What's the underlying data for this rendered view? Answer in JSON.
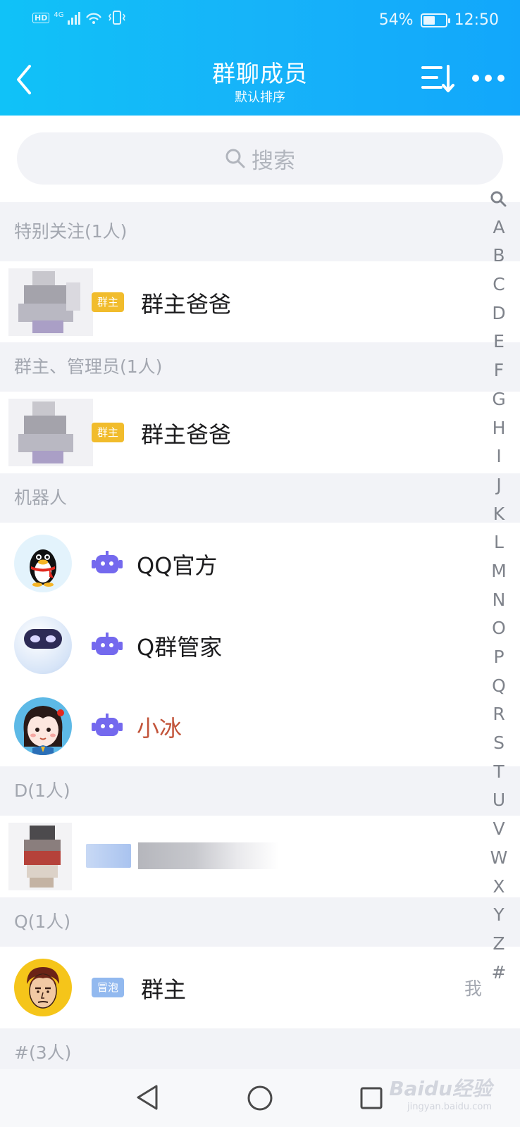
{
  "status_bar": {
    "hd_label": "HD",
    "network_label": "4G",
    "battery_percent_text": "54%",
    "battery_level": 0.54,
    "time": "12:50"
  },
  "header": {
    "title": "群聊成员",
    "subtitle": "默认排序",
    "back_icon": "chevron-left-icon",
    "sort_icon": "sort-icon",
    "more_icon": "more-horizontal-icon"
  },
  "search": {
    "placeholder": "搜索"
  },
  "sections": {
    "special": "特别关注(1人)",
    "admins": "群主、管理员(1人)",
    "robots": "机器人",
    "d": "D(1人)",
    "q": "Q(1人)",
    "hash": "#(3人)"
  },
  "members": {
    "special_member": {
      "tag": "群主",
      "name": "群主爸爸"
    },
    "admin_member": {
      "tag": "群主",
      "name": "群主爸爸"
    },
    "robot_1": {
      "name": "QQ官方"
    },
    "robot_2": {
      "name": "Q群管家"
    },
    "robot_3": {
      "name": "小冰"
    },
    "q_member": {
      "tag": "冒泡",
      "name": "群主",
      "self_label": "我"
    }
  },
  "index_bar": [
    "A",
    "B",
    "C",
    "D",
    "E",
    "F",
    "G",
    "H",
    "I",
    "J",
    "K",
    "L",
    "M",
    "N",
    "O",
    "P",
    "Q",
    "R",
    "S",
    "T",
    "U",
    "V",
    "W",
    "X",
    "Y",
    "Z",
    "#"
  ],
  "watermark": {
    "brand": "Baidu经验",
    "url": "jingyan.baidu.com"
  },
  "colors": {
    "header_gradient_start": "#10c2f8",
    "header_gradient_end": "#12a7fb",
    "owner_tag": "#f1bc2c",
    "bubble_tag": "#92b9ef",
    "robot_icon": "#7469ee",
    "xiaobing_name": "#c2543a"
  }
}
